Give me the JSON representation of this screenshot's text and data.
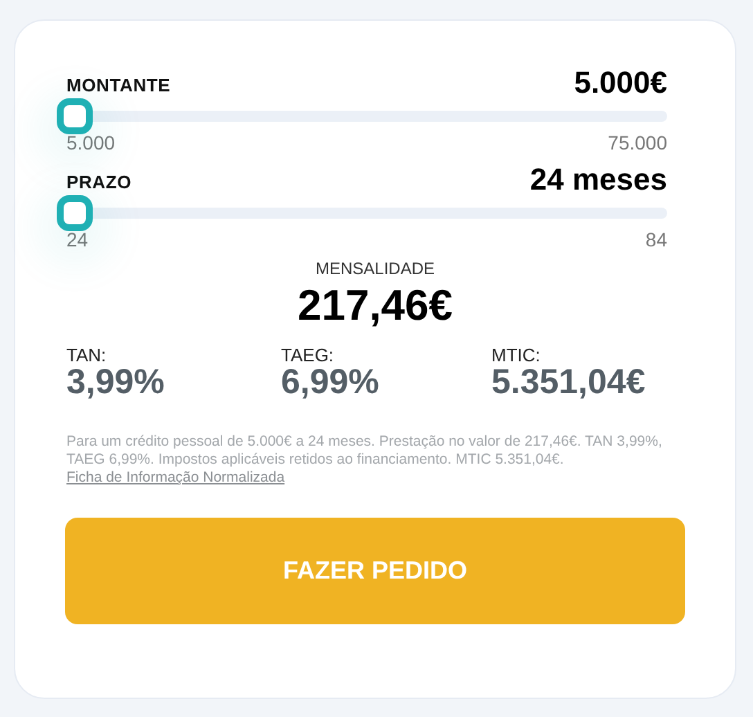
{
  "sliders": [
    {
      "label": "MONTANTE",
      "value": "5.000€",
      "level": 0,
      "min": "5.000",
      "max": "75.000"
    },
    {
      "label": "PRAZO",
      "value": "24 meses",
      "level": 0,
      "min": "24",
      "max": "84"
    }
  ],
  "monthly": {
    "label": "MENSALIDADE",
    "value": "217,46€"
  },
  "rates": [
    {
      "label": "TAN:",
      "value": "3,99%"
    },
    {
      "label": "TAEG:",
      "value": "6,99%"
    },
    {
      "label": "MTIC:",
      "value": "5.351,04€"
    }
  ],
  "disclaimer": "Para um crédito pessoal de 5.000€ a 24 meses. Prestação no valor de 217,46€. TAN 3,99%, TAEG 6,99%. Impostos aplicáveis retidos ao financiamento. MTIC 5.351,04€.",
  "link": "Ficha de Informação Normalizada",
  "button": "FAZER PEDIDO"
}
